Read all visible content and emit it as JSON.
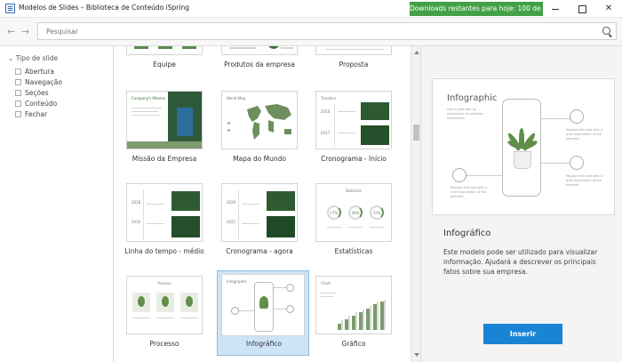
{
  "window": {
    "title": "Modelos de Slides – Biblioteca de Conteúdo iSpring",
    "downloads_badge": "Downloads restantes para hoje: 100 de 100"
  },
  "search": {
    "placeholder": "Pesquisar"
  },
  "sidebar": {
    "header": "Tipo de slide",
    "items": [
      {
        "label": "Abertura",
        "checked": false
      },
      {
        "label": "Navegação",
        "checked": false
      },
      {
        "label": "Seções",
        "checked": false
      },
      {
        "label": "Conteúdo",
        "checked": false
      },
      {
        "label": "Fechar",
        "checked": false
      }
    ]
  },
  "gallery": {
    "items": [
      {
        "label": "Equipe"
      },
      {
        "label": "Produtos da empresa"
      },
      {
        "label": "Proposta"
      },
      {
        "label": "Missão da Empresa",
        "thumb_title": "Company's Mission"
      },
      {
        "label": "Mapa do Mundo",
        "thumb_title": "World Map"
      },
      {
        "label": "Cronograma - Início",
        "thumb_title": "Timeline",
        "years": [
          "2016",
          "2017"
        ]
      },
      {
        "label": "Linha do tempo - médio",
        "years": [
          "2018",
          "2019"
        ]
      },
      {
        "label": "Cronograma - agora",
        "years": [
          "2020",
          "2021"
        ]
      },
      {
        "label": "Estatísticas",
        "thumb_title": "Statistics",
        "percents": [
          "17%",
          "49%",
          "72%"
        ]
      },
      {
        "label": "Processo",
        "thumb_title": "Process"
      },
      {
        "label": "Infográfico",
        "thumb_title": "Infographic",
        "selected": true
      },
      {
        "label": "Gráfico",
        "thumb_title": "Chart",
        "bar_levels": [
          0.22,
          0.36,
          0.48,
          0.58,
          0.7,
          0.84,
          0.95
        ]
      }
    ]
  },
  "preview": {
    "image_title": "Infographic",
    "image_intro": "Use a slide with an infographic to visualize information.",
    "callout_text": "Replace this text with a brief description of the element.",
    "name": "Infográfico",
    "description": "Este modelo pode ser utilizado para visualizar informação. Ajudará a descrever os principais fatos sobre sua empresa.",
    "insert_label": "Inserir"
  },
  "colors": {
    "accent_button": "#1a84d4",
    "badge_green": "#43a047",
    "selection": "#cde4f7",
    "slide_green": "#3f6b3c"
  }
}
